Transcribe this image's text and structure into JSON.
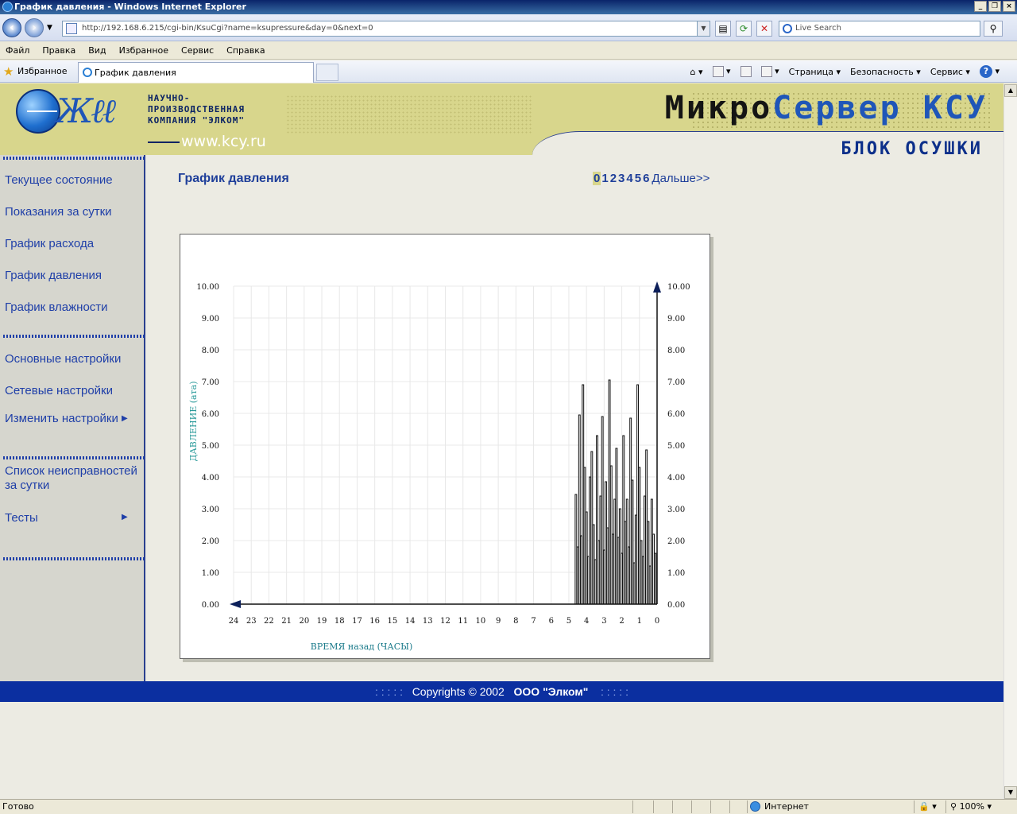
{
  "window": {
    "title": "График давления - Windows Internet Explorer",
    "controls": [
      "_",
      "❐",
      "×"
    ]
  },
  "browser": {
    "address": "http://192.168.6.215/cgi-bin/KsuCgi?name=ksupressure&day=0&next=0",
    "search_placeholder": "Live Search",
    "menu": [
      "Файл",
      "Правка",
      "Вид",
      "Избранное",
      "Сервис",
      "Справка"
    ],
    "favorites_label": "Избранное",
    "tab_title": "График давления",
    "commands": [
      "Страница",
      "Безопасность",
      "Сервис"
    ],
    "status_text": "Готово",
    "zone": "Интернет",
    "zoom": "100%"
  },
  "header": {
    "company_lines": [
      "НАУЧНО-",
      "ПРОИЗВОДСТВЕННАЯ",
      "КОМПАНИЯ \"ЭЛКОМ\""
    ],
    "website": "www.kcy.ru",
    "brand_a": "Микро",
    "brand_b": "Сервер",
    "brand_c": "КСУ",
    "subtitle": "БЛОК ОСУШКИ"
  },
  "sidebar": {
    "items": [
      "Текущее состояние",
      "Показания за сутки",
      "График расхода",
      "График давления",
      "График влажности",
      "Основные настройки",
      "Сетевые настройки",
      "Изменить настройки",
      "Список неисправностей за сутки",
      "Тесты"
    ]
  },
  "page": {
    "title": "График давления",
    "days": [
      "0",
      "1",
      "2",
      "3",
      "4",
      "5",
      "6"
    ],
    "selected_day": "0",
    "next_label": "Дальше>>"
  },
  "footer": {
    "dots": ": : : : :",
    "copyright": "Copyrights  ©  2002",
    "company": "ООО \"Элком\""
  },
  "chart_data": {
    "type": "bar",
    "ylabel": "ДАВЛЕНИЕ (ата)",
    "xlabel": "ВРЕМЯ назад (ЧАСЫ)",
    "ylim": [
      0,
      10
    ],
    "xlim": [
      24,
      0
    ],
    "y_ticks": [
      "0.00",
      "1.00",
      "2.00",
      "3.00",
      "4.00",
      "5.00",
      "6.00",
      "7.00",
      "8.00",
      "9.00",
      "10.00"
    ],
    "x_ticks": [
      "24",
      "23",
      "22",
      "21",
      "20",
      "19",
      "18",
      "17",
      "16",
      "15",
      "14",
      "13",
      "12",
      "11",
      "10",
      "9",
      "8",
      "7",
      "6",
      "5",
      "4",
      "3",
      "2",
      "1",
      "0"
    ],
    "grid": true,
    "hours_ago": [
      4.6,
      4.5,
      4.4,
      4.3,
      4.2,
      4.1,
      4.0,
      3.9,
      3.8,
      3.7,
      3.6,
      3.5,
      3.4,
      3.3,
      3.2,
      3.1,
      3.0,
      2.9,
      2.8,
      2.7,
      2.6,
      2.5,
      2.4,
      2.3,
      2.2,
      2.1,
      2.0,
      1.9,
      1.8,
      1.7,
      1.6,
      1.5,
      1.4,
      1.3,
      1.2,
      1.1,
      1.0,
      0.9,
      0.8,
      0.7,
      0.6,
      0.5,
      0.4,
      0.3,
      0.2,
      0.1
    ],
    "values": [
      3.45,
      1.8,
      5.95,
      2.15,
      6.9,
      4.3,
      2.9,
      1.5,
      4.0,
      4.8,
      2.5,
      1.4,
      5.3,
      2.0,
      3.4,
      5.9,
      1.7,
      3.85,
      2.4,
      7.05,
      4.35,
      2.2,
      3.3,
      4.9,
      2.1,
      3.0,
      1.6,
      5.3,
      2.6,
      3.3,
      1.8,
      5.85,
      3.9,
      1.3,
      2.8,
      6.9,
      4.3,
      2.0,
      1.5,
      3.4,
      4.85,
      2.6,
      1.2,
      3.3,
      2.2,
      1.6
    ]
  }
}
